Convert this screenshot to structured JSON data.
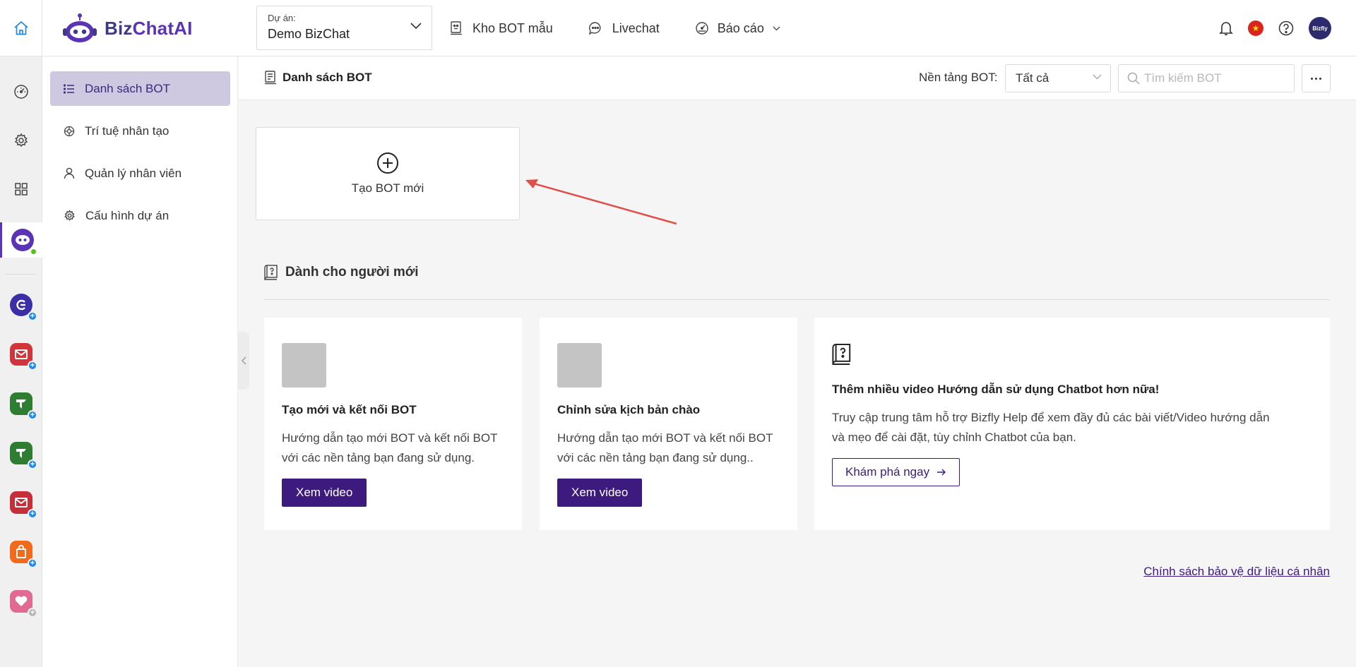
{
  "header": {
    "logo": {
      "part1": "Biz",
      "part2": "ChatAI"
    },
    "project": {
      "label": "Dự án:",
      "value": "Demo BizChat"
    },
    "nav": [
      {
        "label": "Kho BOT mẫu",
        "icon": "bot-template-icon"
      },
      {
        "label": "Livechat",
        "icon": "chat-bubble-icon"
      },
      {
        "label": "Báo cáo",
        "icon": "dashboard-gauge-icon"
      }
    ],
    "avatar_text": "Bizfly"
  },
  "rail": {
    "icons": [
      "home-icon",
      "dashboard-icon",
      "settings-icon",
      "apps-grid-icon",
      "bizchat-bot-icon"
    ],
    "apps": [
      "bizfly-crm-app",
      "bizfly-mail-app",
      "bizfly-tele-app",
      "bizfly-tele-app-2",
      "bizfly-mail-app-2",
      "bizfly-shop-app",
      "bizfly-care-app"
    ]
  },
  "sidebar": {
    "items": [
      {
        "label": "Danh sách BOT",
        "icon": "list-icon",
        "active": true
      },
      {
        "label": "Trí tuệ nhân tạo",
        "icon": "ai-icon",
        "active": false
      },
      {
        "label": "Quản lý nhân viên",
        "icon": "user-icon",
        "active": false
      },
      {
        "label": "Cấu hình dự án",
        "icon": "gear-icon",
        "active": false
      }
    ]
  },
  "main": {
    "title": "Danh sách BOT",
    "platform_label": "Nền tảng BOT:",
    "platform_value": "Tất cả",
    "search_placeholder": "Tìm kiếm BOT",
    "create_label": "Tạo BOT mới",
    "section_title": "Dành cho người mới",
    "cards": [
      {
        "title": "Tạo mới và kết nối BOT",
        "desc_line1": "Hướng dẫn tạo mới BOT và kết nối BOT",
        "desc_line2": "với các nền tảng bạn đang sử dụng.",
        "button": "Xem video"
      },
      {
        "title": "Chỉnh sửa kịch bản chào",
        "desc_line1": "Hướng dẫn tạo mới BOT và kết nối BOT",
        "desc_line2": "với các nền tảng bạn đang sử dụng..",
        "button": "Xem video"
      },
      {
        "title": "Thêm nhiều video Hướng dẫn sử dụng Chatbot hơn nữa!",
        "desc_line1": "Truy cập trung tâm hỗ trợ Bizfly Help để xem đầy đủ các bài viết/Video hướng dẫn",
        "desc_line2": "và mẹo để cài đặt, tùy chỉnh Chatbot của bạn.",
        "button": "Khám phá ngay"
      }
    ],
    "footer_link": "Chính sách bảo vệ dữ liệu cá nhân"
  },
  "colors": {
    "brand": "#3c1a7e",
    "active_bg": "#cec8e0",
    "annotation_arrow": "#e0504a"
  }
}
